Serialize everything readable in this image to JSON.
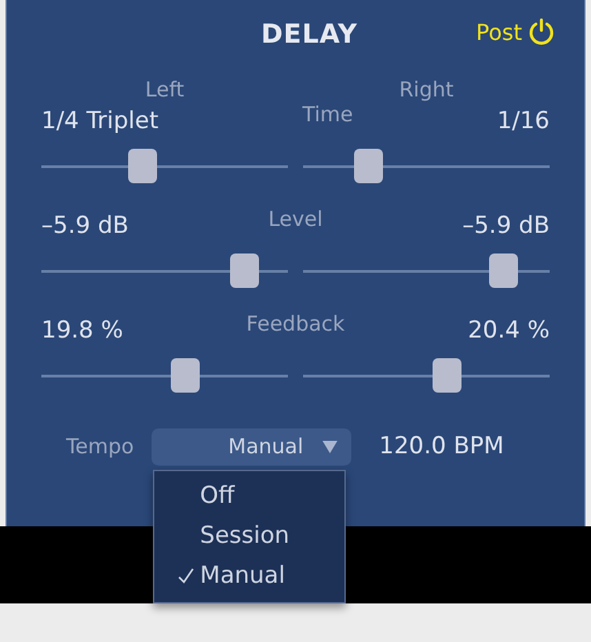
{
  "title": "DELAY",
  "post_toggle": {
    "label": "Post",
    "on": true
  },
  "params": [
    {
      "name": "Time",
      "left": {
        "heading": "Left",
        "value": "1/4 Triplet",
        "level": 0.41
      },
      "right": {
        "heading": "Right",
        "value": "1/16",
        "level": 0.26
      }
    },
    {
      "name": "Level",
      "left": {
        "value": "–5.9 dB",
        "level": 0.82
      },
      "right": {
        "value": "–5.9 dB",
        "level": 0.81
      }
    },
    {
      "name": "Feedback",
      "left": {
        "value": "19.8 %",
        "level": 0.58
      },
      "right": {
        "value": "20.4 %",
        "level": 0.58
      }
    }
  ],
  "tempo": {
    "label": "Tempo",
    "mode": "Manual",
    "bpm": "120.0 BPM",
    "expanded": true,
    "options": [
      {
        "label": "Off",
        "selected": false
      },
      {
        "label": "Session",
        "selected": false
      },
      {
        "label": "Manual",
        "selected": true
      }
    ]
  }
}
